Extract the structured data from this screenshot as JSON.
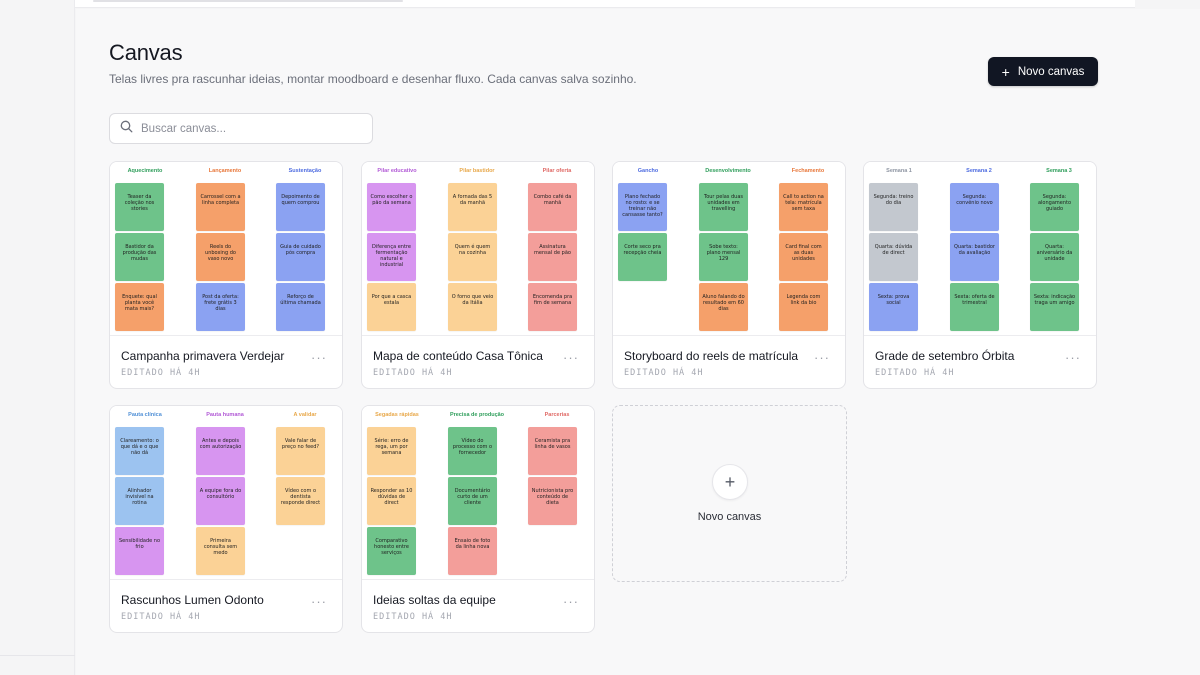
{
  "header": {
    "title": "Canvas",
    "subtitle": "Telas livres pra rascunhar ideias, montar moodboard e desenhar fluxo. Cada canvas salva sozinho.",
    "new_button_label": "Novo canvas",
    "new_button_icon": "plus-icon"
  },
  "search": {
    "placeholder": "Buscar canvas...",
    "value": "",
    "icon": "search-icon"
  },
  "colors": {
    "green": "#6ec38a",
    "orange": "#f5a06a",
    "blue": "#8ba2f2",
    "purple": "#d795f0",
    "peach": "#fbd296",
    "red": "#f39e9a",
    "gray": "#c3c8cf",
    "lightblue": "#9cc3f0"
  },
  "cards": [
    {
      "name": "Campanha primavera Verdejar",
      "edited": "EDITADO HÁ 4H",
      "menu": "···",
      "columns": [
        {
          "title": "Aquecimento",
          "color": "#2f9e5b",
          "notes": [
            {
              "text": "Teaser da coleção nos stories",
              "color": "#6ec38a"
            },
            {
              "text": "Bastidor da produção das mudas",
              "color": "#6ec38a"
            },
            {
              "text": "Enquete: qual planta você mata mais?",
              "color": "#f5a06a"
            }
          ]
        },
        {
          "title": "Lançamento",
          "color": "#e8773a",
          "notes": [
            {
              "text": "Carrossel com a linha completa",
              "color": "#f5a06a"
            },
            {
              "text": "Reels do unboxing do vaso novo",
              "color": "#f5a06a"
            },
            {
              "text": "Post da oferta: frete grátis 3 dias",
              "color": "#8ba2f2"
            }
          ]
        },
        {
          "title": "Sustentação",
          "color": "#4d6be0",
          "notes": [
            {
              "text": "Depoimento de quem comprou",
              "color": "#8ba2f2"
            },
            {
              "text": "Guia de cuidado pós compra",
              "color": "#8ba2f2"
            },
            {
              "text": "Reforço de última chamada",
              "color": "#8ba2f2"
            }
          ]
        }
      ]
    },
    {
      "name": "Mapa de conteúdo Casa Tônica",
      "edited": "EDITADO HÁ 4H",
      "menu": "···",
      "columns": [
        {
          "title": "Pilar educativo",
          "color": "#b25ad6",
          "notes": [
            {
              "text": "Como escolher o pão da semana",
              "color": "#d795f0"
            },
            {
              "text": "Diferença entre fermentação natural e industrial",
              "color": "#d795f0"
            },
            {
              "text": "Por que a casca estala",
              "color": "#fbd296"
            }
          ]
        },
        {
          "title": "Pilar bastidor",
          "color": "#e8a84a",
          "notes": [
            {
              "text": "A fornada das 5 da manhã",
              "color": "#fbd296"
            },
            {
              "text": "Quem é quem na cozinha",
              "color": "#fbd296"
            },
            {
              "text": "O forno que veio da Itália",
              "color": "#fbd296"
            }
          ]
        },
        {
          "title": "Pilar oferta",
          "color": "#e06a66",
          "notes": [
            {
              "text": "Combo café da manhã",
              "color": "#f39e9a"
            },
            {
              "text": "Assinatura mensal de pão",
              "color": "#f39e9a"
            },
            {
              "text": "Encomenda pra fim de semana",
              "color": "#f39e9a"
            }
          ]
        }
      ]
    },
    {
      "name": "Storyboard do reels de matrícula",
      "edited": "EDITADO HÁ 4H",
      "menu": "···",
      "columns": [
        {
          "title": "Gancho",
          "color": "#4d6be0",
          "notes": [
            {
              "text": "Plano fechado no rosto: e se treinar não cansasse tanto?",
              "color": "#8ba2f2"
            },
            {
              "text": "Corte seco pra recepção cheia",
              "color": "#6ec38a"
            }
          ]
        },
        {
          "title": "Desenvolvimento",
          "color": "#2f9e5b",
          "notes": [
            {
              "text": "Tour pelas duas unidades em travelling",
              "color": "#6ec38a"
            },
            {
              "text": "Sobe texto: plano mensal 129",
              "color": "#6ec38a"
            },
            {
              "text": "Aluno falando do resultado em 60 dias",
              "color": "#f5a06a"
            }
          ]
        },
        {
          "title": "Fechamento",
          "color": "#e8773a",
          "notes": [
            {
              "text": "Call to action na tela: matrícula sem taxa",
              "color": "#f5a06a"
            },
            {
              "text": "Card final com as duas unidades",
              "color": "#f5a06a"
            },
            {
              "text": "Legenda com link da bio",
              "color": "#f5a06a"
            }
          ]
        }
      ]
    },
    {
      "name": "Grade de setembro Órbita",
      "edited": "EDITADO HÁ 4H",
      "menu": "···",
      "columns": [
        {
          "title": "Semana 1",
          "color": "#8f96a3",
          "notes": [
            {
              "text": "Segunda: treino do dia",
              "color": "#c3c8cf"
            },
            {
              "text": "Quarta: dúvida de direct",
              "color": "#c3c8cf"
            },
            {
              "text": "Sexta: prova social",
              "color": "#8ba2f2"
            }
          ]
        },
        {
          "title": "Semana 2",
          "color": "#4d6be0",
          "notes": [
            {
              "text": "Segunda: convênio novo",
              "color": "#8ba2f2"
            },
            {
              "text": "Quarta: bastidor da avaliação",
              "color": "#8ba2f2"
            },
            {
              "text": "Sexta: oferta de trimestral",
              "color": "#6ec38a"
            }
          ]
        },
        {
          "title": "Semana 3",
          "color": "#2f9e5b",
          "notes": [
            {
              "text": "Segunda: alongamento guiado",
              "color": "#6ec38a"
            },
            {
              "text": "Quarta: aniversário da unidade",
              "color": "#6ec38a"
            },
            {
              "text": "Sexta: indicação traga um amigo",
              "color": "#6ec38a"
            }
          ]
        }
      ]
    },
    {
      "name": "Rascunhos Lumen Odonto",
      "edited": "EDITADO HÁ 4H",
      "menu": "···",
      "columns": [
        {
          "title": "Pauta clínica",
          "color": "#4f8fd6",
          "notes": [
            {
              "text": "Clareamento: o que dá e o que não dá",
              "color": "#9cc3f0"
            },
            {
              "text": "Alinhador invisível na rotina",
              "color": "#9cc3f0"
            },
            {
              "text": "Sensibilidade no frio",
              "color": "#d795f0"
            }
          ]
        },
        {
          "title": "Pauta humana",
          "color": "#b25ad6",
          "notes": [
            {
              "text": "Antes e depois com autorização",
              "color": "#d795f0"
            },
            {
              "text": "A equipe fora do consultório",
              "color": "#d795f0"
            },
            {
              "text": "Primeira consulta sem medo",
              "color": "#fbd296"
            }
          ]
        },
        {
          "title": "A validar",
          "color": "#e8a84a",
          "notes": [
            {
              "text": "Vale falar de preço no feed?",
              "color": "#fbd296"
            },
            {
              "text": "Vídeo com o dentista responde direct",
              "color": "#fbd296"
            }
          ]
        }
      ]
    },
    {
      "name": "Ideias soltas da equipe",
      "edited": "EDITADO HÁ 4H",
      "menu": "···",
      "columns": [
        {
          "title": "Segadas rápidas",
          "color": "#e8a84a",
          "notes": [
            {
              "text": "Série: erro de rega, um por semana",
              "color": "#fbd296"
            },
            {
              "text": "Responder as 10 dúvidas de direct",
              "color": "#fbd296"
            },
            {
              "text": "Comparativo honesto entre serviços",
              "color": "#6ec38a"
            }
          ]
        },
        {
          "title": "Precisa de produção",
          "color": "#2f9e5b",
          "notes": [
            {
              "text": "Vídeo do processo com o fornecedor",
              "color": "#6ec38a"
            },
            {
              "text": "Documentário curto de um cliente",
              "color": "#6ec38a"
            },
            {
              "text": "Ensaio de foto da linha nova",
              "color": "#f39e9a"
            }
          ]
        },
        {
          "title": "Parcerias",
          "color": "#e06a66",
          "notes": [
            {
              "text": "Ceramista pra linha de vasos",
              "color": "#f39e9a"
            },
            {
              "text": "Nutricionista pro conteúdo de dieta",
              "color": "#f39e9a"
            }
          ]
        }
      ]
    }
  ],
  "new_card": {
    "label": "Novo canvas",
    "icon": "plus-icon"
  }
}
